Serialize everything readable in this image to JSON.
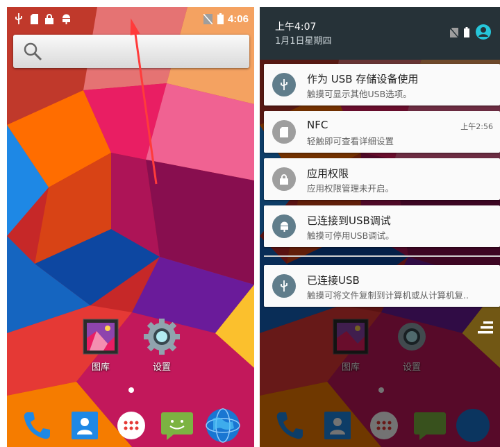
{
  "left_screen": {
    "status_bar": {
      "time": "4:06",
      "left_icons": [
        "usb-icon",
        "sd-card-icon",
        "lock-icon",
        "android-debug-icon"
      ],
      "right_icons": [
        "no-sim-icon",
        "battery-icon"
      ]
    },
    "search": {
      "icon": "search-icon"
    },
    "apps": [
      {
        "label": "图库",
        "icon": "gallery-icon"
      },
      {
        "label": "设置",
        "icon": "settings-gear-icon"
      }
    ],
    "dock": [
      "phone-icon",
      "contacts-icon",
      "app-drawer-icon",
      "messaging-icon",
      "browser-globe-icon"
    ],
    "annotation": "red-arrow-swipe-down"
  },
  "right_screen": {
    "header": {
      "time": "上午4:07",
      "date": "1月1日星期四",
      "icons": [
        "no-sim-icon",
        "battery-icon",
        "user-avatar-icon"
      ]
    },
    "notifications": [
      {
        "title": "作为 USB 存储设备使用",
        "subtitle": "触摸可显示其他USB选项。",
        "time": "",
        "icon": "usb-icon"
      },
      {
        "title": "NFC",
        "subtitle": "轻触即可查看详细设置",
        "time": "上午2:56",
        "icon": "sd-card-icon"
      },
      {
        "title": "应用权限",
        "subtitle": "应用权限管理未开启。",
        "time": "",
        "icon": "lock-icon"
      },
      {
        "title": "已连接到USB调试",
        "subtitle": "触摸可停用USB调试。",
        "time": "",
        "icon": "android-debug-icon"
      },
      {
        "title": "已连接USB",
        "subtitle": "触摸可将文件复制到计算机或从计算机复..",
        "time": "",
        "icon": "usb-icon"
      }
    ],
    "apps": [
      {
        "label": "图库"
      },
      {
        "label": "设置"
      }
    ]
  }
}
